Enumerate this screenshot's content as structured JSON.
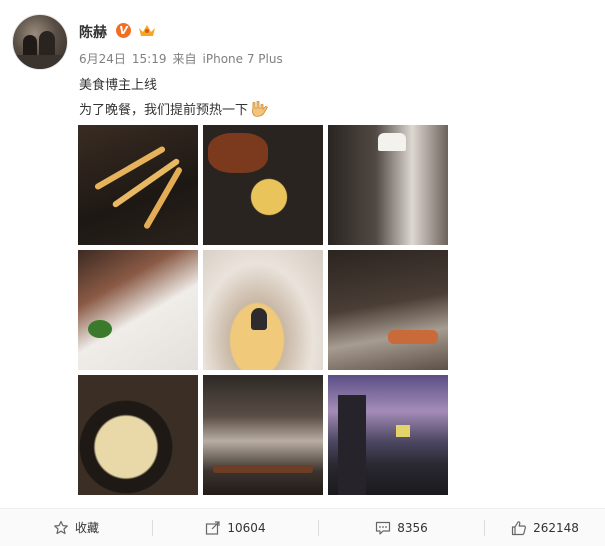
{
  "user": {
    "name": "陈赫",
    "verified_badge": "V"
  },
  "post": {
    "date": "6月24日",
    "time": "15:19",
    "source_prefix": "来自",
    "source": "iPhone 7 Plus",
    "text_line1": "美食博主上线",
    "text_line2": "为了晚餐，我们提前预热一下"
  },
  "photos": {
    "count": 9
  },
  "actions": {
    "favorite_label": "收藏",
    "repost_count": "10604",
    "comment_count": "8356",
    "like_count": "262148"
  },
  "colors": {
    "verified_orange": "#f26d22",
    "text_gray": "#808080"
  },
  "icons": {
    "favorite": "star-outline-icon",
    "repost": "share-arrow-icon",
    "comment": "speech-bubble-icon",
    "like": "thumbs-up-icon"
  }
}
